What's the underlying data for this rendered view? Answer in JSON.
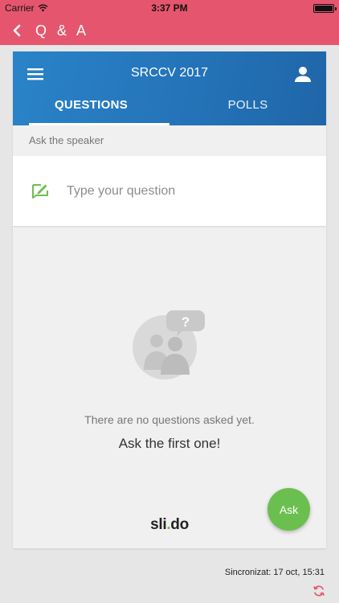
{
  "status_bar": {
    "carrier": "Carrier",
    "time": "3:37 PM"
  },
  "nav": {
    "back_icon": "chevron-left-icon",
    "title": "Q & A"
  },
  "event": {
    "title": "SRCCV 2017",
    "menu_icon": "hamburger-menu-icon",
    "user_icon": "user-icon"
  },
  "tabs": [
    {
      "label": "QUESTIONS",
      "active": true
    },
    {
      "label": "POLLS",
      "active": false
    }
  ],
  "ask": {
    "section_label": "Ask the speaker",
    "placeholder": "Type your question",
    "icon": "edit-icon"
  },
  "empty_state": {
    "illustration": "no-questions-icon",
    "message": "There are no questions asked yet.",
    "cta": "Ask the first one!"
  },
  "branding": {
    "logo_part1": "sli",
    "logo_dot": ".",
    "logo_part2": "do"
  },
  "ask_button": {
    "label": "Ask"
  },
  "footer": {
    "sync_text": "Sincronizat: 17 oct, 15:31",
    "refresh_icon": "refresh-icon"
  },
  "colors": {
    "nav_bar": "#e5566e",
    "header_blue": "#2472b7",
    "accent_green": "#6bbf4e",
    "refresh_red": "#e5566e"
  }
}
